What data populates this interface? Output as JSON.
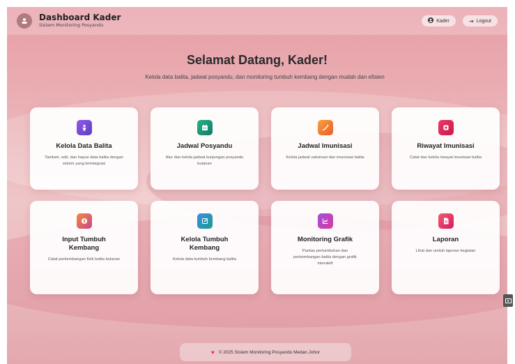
{
  "header": {
    "title": "Dashboard Kader",
    "subtitle": "Sistem Monitoring Posyandu",
    "user_label": "Kader",
    "logout_label": "Logout"
  },
  "hero": {
    "title": "Selamat Datang, Kader!",
    "subtitle": "Kelola data balita, jadwal posyandu, dan monitoring tumbuh kembang dengan mudah dan efisien"
  },
  "cards": [
    {
      "title": "Kelola Data Balita",
      "desc": "Tambah, edit, dan hapus data balita dengan sistem yang terintegrasi",
      "icon": "baby-icon",
      "color": "#7b4fd6"
    },
    {
      "title": "Jadwal Posyandu",
      "desc": "Atur dan kelola jadwal kunjungan posyandu bulanan",
      "icon": "calendar-icon",
      "color": "#1f9a7a"
    },
    {
      "title": "Jadwal Imunisasi",
      "desc": "Kelola jadwal vaksinasi dan imunisasi balita",
      "icon": "syringe-icon",
      "color": "#f07a2e"
    },
    {
      "title": "Riwayat Imunisasi",
      "desc": "Catat dan kelola riwayat imunisasi balita",
      "icon": "history-icon",
      "color": "#e0245e"
    },
    {
      "title": "Input Tumbuh Kembang",
      "desc": "Catat perkembangan fisik balita bulanan",
      "icon": "ruler-icon",
      "color": "#e35f3a"
    },
    {
      "title": "Kelola Tumbuh Kembang",
      "desc": "Kelola data tumbuh kembang balita",
      "icon": "edit-icon",
      "color": "#2f7fd8"
    },
    {
      "title": "Monitoring Grafik",
      "desc": "Pantau pertumbuhan dan perkembangan balita dengan grafik interaktif",
      "icon": "chart-icon",
      "color": "#8a3fd0"
    },
    {
      "title": "Laporan",
      "desc": "Lihat dan unduh laporan kegiatan",
      "icon": "report-icon",
      "color": "#e8395a"
    }
  ],
  "footer": {
    "text": "© 2025 Sistem Monitoring Posyandu Medan Johor"
  }
}
